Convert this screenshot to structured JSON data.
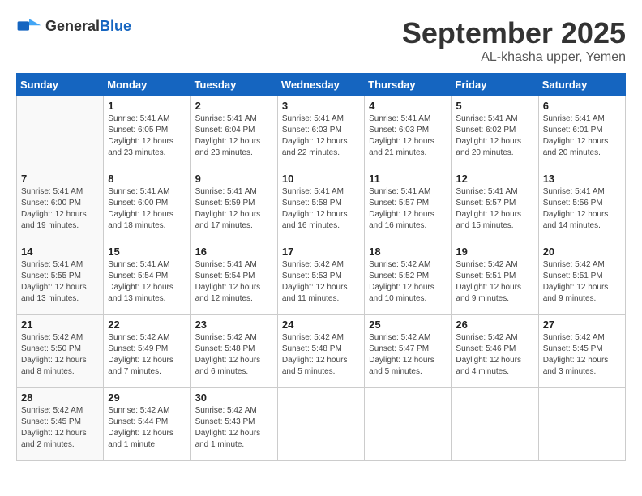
{
  "header": {
    "logo_general": "General",
    "logo_blue": "Blue",
    "month": "September 2025",
    "location": "AL-khasha upper, Yemen"
  },
  "days_of_week": [
    "Sunday",
    "Monday",
    "Tuesday",
    "Wednesday",
    "Thursday",
    "Friday",
    "Saturday"
  ],
  "weeks": [
    [
      {
        "day": "",
        "info": ""
      },
      {
        "day": "1",
        "info": "Sunrise: 5:41 AM\nSunset: 6:05 PM\nDaylight: 12 hours\nand 23 minutes."
      },
      {
        "day": "2",
        "info": "Sunrise: 5:41 AM\nSunset: 6:04 PM\nDaylight: 12 hours\nand 23 minutes."
      },
      {
        "day": "3",
        "info": "Sunrise: 5:41 AM\nSunset: 6:03 PM\nDaylight: 12 hours\nand 22 minutes."
      },
      {
        "day": "4",
        "info": "Sunrise: 5:41 AM\nSunset: 6:03 PM\nDaylight: 12 hours\nand 21 minutes."
      },
      {
        "day": "5",
        "info": "Sunrise: 5:41 AM\nSunset: 6:02 PM\nDaylight: 12 hours\nand 20 minutes."
      },
      {
        "day": "6",
        "info": "Sunrise: 5:41 AM\nSunset: 6:01 PM\nDaylight: 12 hours\nand 20 minutes."
      }
    ],
    [
      {
        "day": "7",
        "info": "Sunrise: 5:41 AM\nSunset: 6:00 PM\nDaylight: 12 hours\nand 19 minutes."
      },
      {
        "day": "8",
        "info": "Sunrise: 5:41 AM\nSunset: 6:00 PM\nDaylight: 12 hours\nand 18 minutes."
      },
      {
        "day": "9",
        "info": "Sunrise: 5:41 AM\nSunset: 5:59 PM\nDaylight: 12 hours\nand 17 minutes."
      },
      {
        "day": "10",
        "info": "Sunrise: 5:41 AM\nSunset: 5:58 PM\nDaylight: 12 hours\nand 16 minutes."
      },
      {
        "day": "11",
        "info": "Sunrise: 5:41 AM\nSunset: 5:57 PM\nDaylight: 12 hours\nand 16 minutes."
      },
      {
        "day": "12",
        "info": "Sunrise: 5:41 AM\nSunset: 5:57 PM\nDaylight: 12 hours\nand 15 minutes."
      },
      {
        "day": "13",
        "info": "Sunrise: 5:41 AM\nSunset: 5:56 PM\nDaylight: 12 hours\nand 14 minutes."
      }
    ],
    [
      {
        "day": "14",
        "info": "Sunrise: 5:41 AM\nSunset: 5:55 PM\nDaylight: 12 hours\nand 13 minutes."
      },
      {
        "day": "15",
        "info": "Sunrise: 5:41 AM\nSunset: 5:54 PM\nDaylight: 12 hours\nand 13 minutes."
      },
      {
        "day": "16",
        "info": "Sunrise: 5:41 AM\nSunset: 5:54 PM\nDaylight: 12 hours\nand 12 minutes."
      },
      {
        "day": "17",
        "info": "Sunrise: 5:42 AM\nSunset: 5:53 PM\nDaylight: 12 hours\nand 11 minutes."
      },
      {
        "day": "18",
        "info": "Sunrise: 5:42 AM\nSunset: 5:52 PM\nDaylight: 12 hours\nand 10 minutes."
      },
      {
        "day": "19",
        "info": "Sunrise: 5:42 AM\nSunset: 5:51 PM\nDaylight: 12 hours\nand 9 minutes."
      },
      {
        "day": "20",
        "info": "Sunrise: 5:42 AM\nSunset: 5:51 PM\nDaylight: 12 hours\nand 9 minutes."
      }
    ],
    [
      {
        "day": "21",
        "info": "Sunrise: 5:42 AM\nSunset: 5:50 PM\nDaylight: 12 hours\nand 8 minutes."
      },
      {
        "day": "22",
        "info": "Sunrise: 5:42 AM\nSunset: 5:49 PM\nDaylight: 12 hours\nand 7 minutes."
      },
      {
        "day": "23",
        "info": "Sunrise: 5:42 AM\nSunset: 5:48 PM\nDaylight: 12 hours\nand 6 minutes."
      },
      {
        "day": "24",
        "info": "Sunrise: 5:42 AM\nSunset: 5:48 PM\nDaylight: 12 hours\nand 5 minutes."
      },
      {
        "day": "25",
        "info": "Sunrise: 5:42 AM\nSunset: 5:47 PM\nDaylight: 12 hours\nand 5 minutes."
      },
      {
        "day": "26",
        "info": "Sunrise: 5:42 AM\nSunset: 5:46 PM\nDaylight: 12 hours\nand 4 minutes."
      },
      {
        "day": "27",
        "info": "Sunrise: 5:42 AM\nSunset: 5:45 PM\nDaylight: 12 hours\nand 3 minutes."
      }
    ],
    [
      {
        "day": "28",
        "info": "Sunrise: 5:42 AM\nSunset: 5:45 PM\nDaylight: 12 hours\nand 2 minutes."
      },
      {
        "day": "29",
        "info": "Sunrise: 5:42 AM\nSunset: 5:44 PM\nDaylight: 12 hours\nand 1 minute."
      },
      {
        "day": "30",
        "info": "Sunrise: 5:42 AM\nSunset: 5:43 PM\nDaylight: 12 hours\nand 1 minute."
      },
      {
        "day": "",
        "info": ""
      },
      {
        "day": "",
        "info": ""
      },
      {
        "day": "",
        "info": ""
      },
      {
        "day": "",
        "info": ""
      }
    ]
  ]
}
